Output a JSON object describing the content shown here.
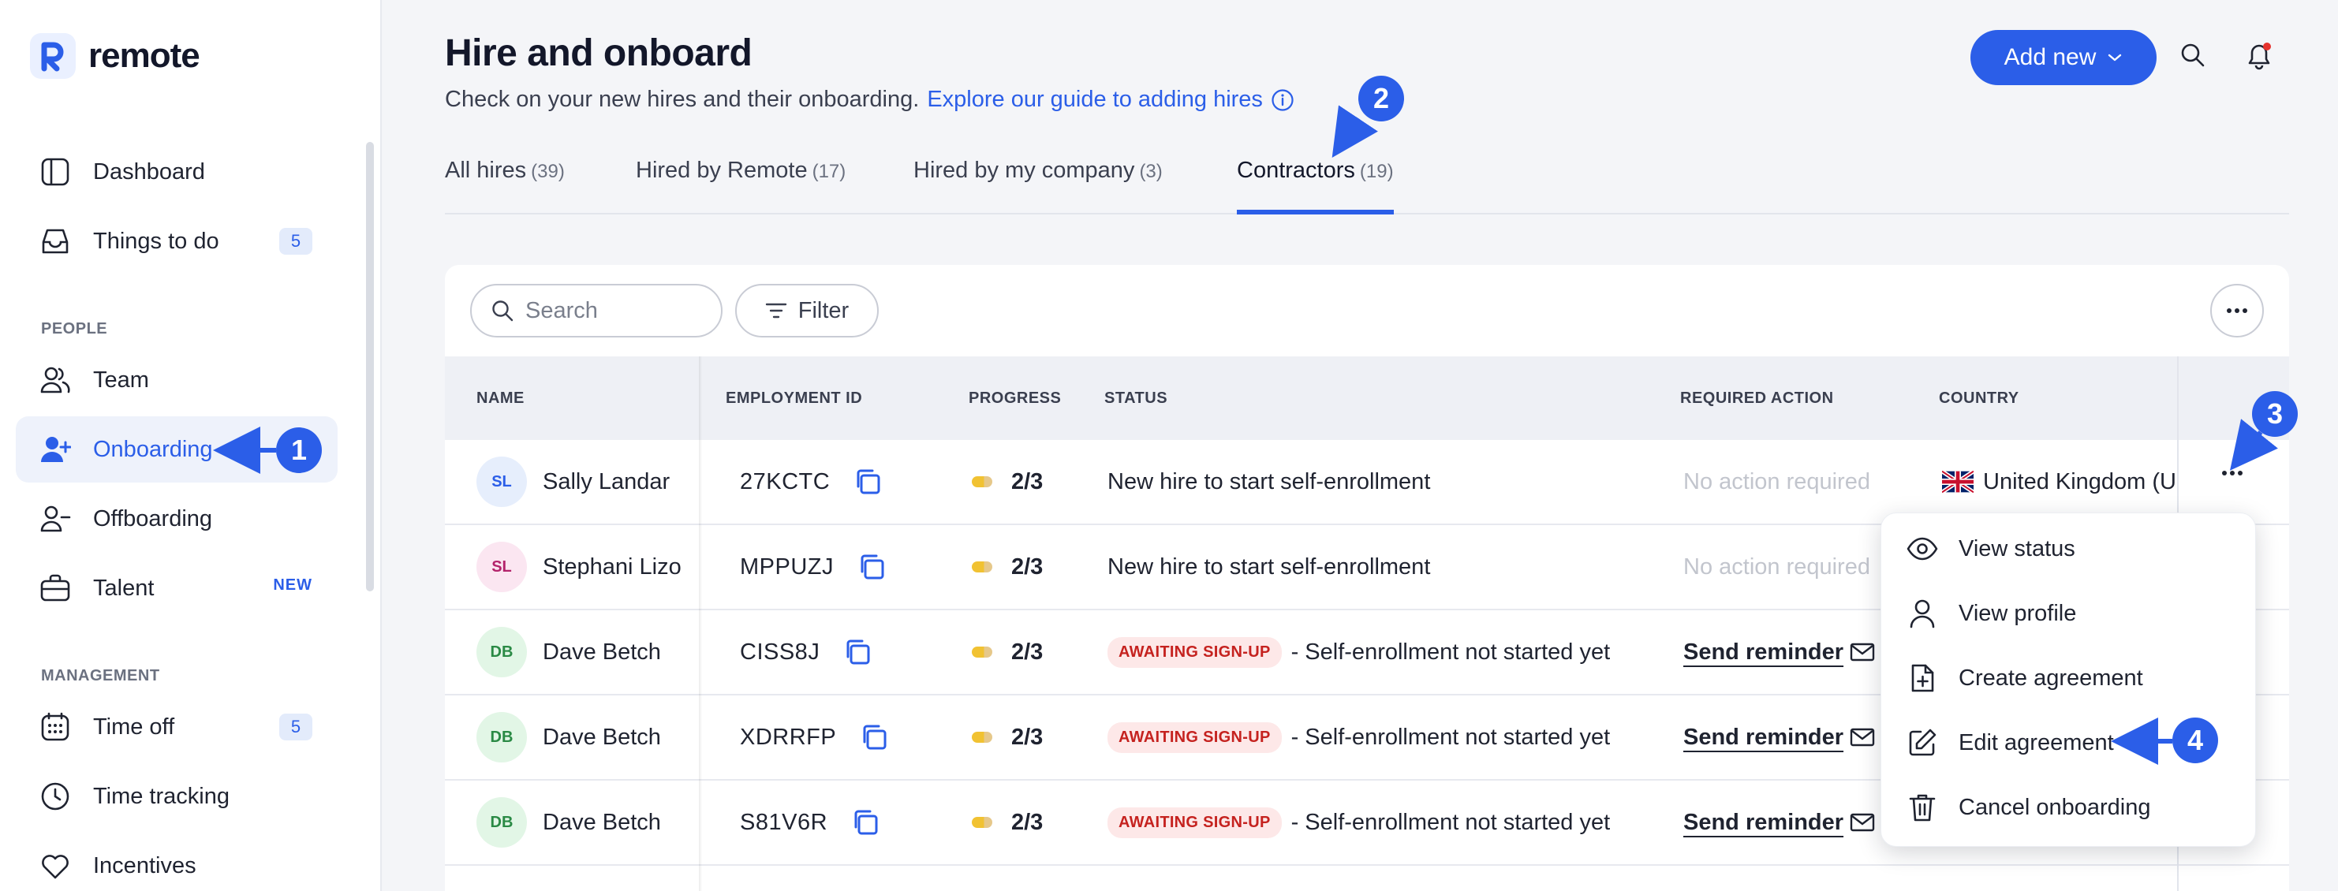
{
  "app": {
    "brand": "remote"
  },
  "sidebar": {
    "items": [
      {
        "label": "Dashboard",
        "icon": "dashboard-icon"
      },
      {
        "label": "Things to do",
        "icon": "inbox-icon",
        "badge": "5"
      },
      {
        "label": "Team",
        "icon": "team-icon"
      },
      {
        "label": "Onboarding",
        "icon": "user-plus-icon",
        "active": true
      },
      {
        "label": "Offboarding",
        "icon": "user-minus-icon"
      },
      {
        "label": "Talent",
        "icon": "briefcase-icon",
        "tag": "NEW"
      },
      {
        "label": "Time off",
        "icon": "calendar-icon",
        "badge": "5"
      },
      {
        "label": "Time tracking",
        "icon": "clock-icon"
      },
      {
        "label": "Incentives",
        "icon": "heart-icon"
      }
    ],
    "sections": {
      "people": "PEOPLE",
      "management": "MANAGEMENT"
    }
  },
  "header": {
    "title": "Hire and onboard",
    "subtitle": "Check on your new hires and their onboarding.",
    "guide_link": "Explore our guide to adding hires",
    "add_new": "Add new"
  },
  "tabs": [
    {
      "label": "All hires",
      "count": "(39)"
    },
    {
      "label": "Hired by Remote",
      "count": "(17)"
    },
    {
      "label": "Hired by my company",
      "count": "(3)"
    },
    {
      "label": "Contractors",
      "count": "(19)",
      "active": true
    }
  ],
  "toolbar": {
    "search_placeholder": "Search",
    "filter_label": "Filter"
  },
  "table": {
    "columns": [
      "NAME",
      "EMPLOYMENT ID",
      "PROGRESS",
      "STATUS",
      "REQUIRED ACTION",
      "COUNTRY"
    ],
    "rows": [
      {
        "initials": "SL",
        "name": "Sally Landar",
        "employment_id": "27KCTC",
        "progress": "2/3",
        "status": "New hire to start self-enrollment",
        "badge": "",
        "action": "No action required",
        "country": "United Kingdom (U"
      },
      {
        "initials": "SL",
        "name": "Stephani Lizo",
        "employment_id": "MPPUZJ",
        "progress": "2/3",
        "status": "New hire to start self-enrollment",
        "badge": "",
        "action": "No action required",
        "country": ""
      },
      {
        "initials": "DB",
        "name": "Dave Betch",
        "employment_id": "CISS8J",
        "progress": "2/3",
        "status": "- Self-enrollment not started yet",
        "badge": "AWAITING SIGN-UP",
        "action": "Send reminder",
        "country": ""
      },
      {
        "initials": "DB",
        "name": "Dave Betch",
        "employment_id": "XDRRFP",
        "progress": "2/3",
        "status": "- Self-enrollment not started yet",
        "badge": "AWAITING SIGN-UP",
        "action": "Send reminder",
        "country": ""
      },
      {
        "initials": "DB",
        "name": "Dave Betch",
        "employment_id": "S81V6R",
        "progress": "2/3",
        "status": "- Self-enrollment not started yet",
        "badge": "AWAITING SIGN-UP",
        "action": "Send reminder",
        "country": ""
      }
    ]
  },
  "row_menu": {
    "items": [
      {
        "label": "View status",
        "icon": "eye-icon"
      },
      {
        "label": "View profile",
        "icon": "user-icon"
      },
      {
        "label": "Create agreement",
        "icon": "file-plus-icon"
      },
      {
        "label": "Edit agreement",
        "icon": "edit-icon"
      },
      {
        "label": "Cancel onboarding",
        "icon": "trash-icon"
      }
    ]
  },
  "callouts": [
    "1",
    "2",
    "3",
    "4"
  ],
  "colors": {
    "accent": "#2b5ee8",
    "badge_bg": "#fde8e8",
    "badge_text": "#c5221f"
  }
}
